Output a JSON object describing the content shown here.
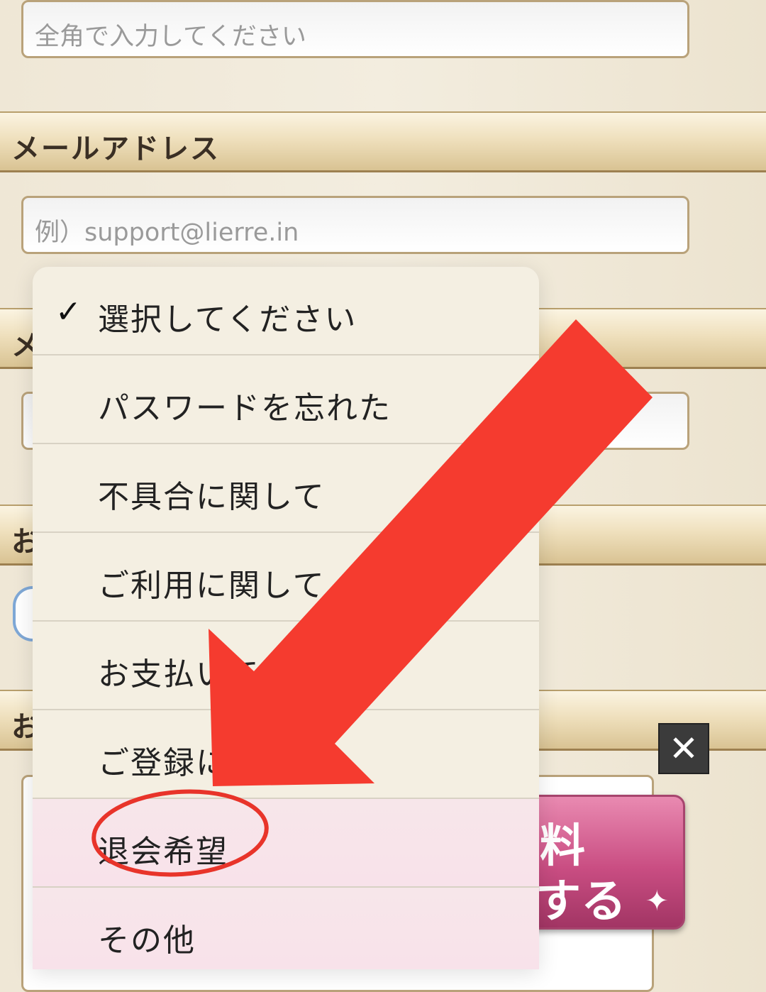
{
  "form": {
    "name_placeholder": "全角で入力してください",
    "email_section_label": "メールアドレス",
    "email_placeholder": "例）support@lierre.in",
    "section3_label_partial": "メ",
    "section4_label_partial": "お",
    "section5_label_partial": "お"
  },
  "dropdown": {
    "items": [
      {
        "label": "選択してください",
        "selected": true
      },
      {
        "label": "パスワードを忘れた",
        "selected": false
      },
      {
        "label": "不具合に関して",
        "selected": false
      },
      {
        "label": "ご利用に関して",
        "selected": false
      },
      {
        "label": "お支払いて",
        "selected": false
      },
      {
        "label": "ご登録に",
        "selected": false
      },
      {
        "label": "退会希望",
        "selected": false
      },
      {
        "label": "その他",
        "selected": false
      }
    ],
    "check_glyph": "✓"
  },
  "banner": {
    "line1": "料",
    "line2": "する"
  },
  "close_glyph": "✕",
  "annotation": {
    "arrow_color": "#f53b2f",
    "circle_color": "#e8342a"
  }
}
